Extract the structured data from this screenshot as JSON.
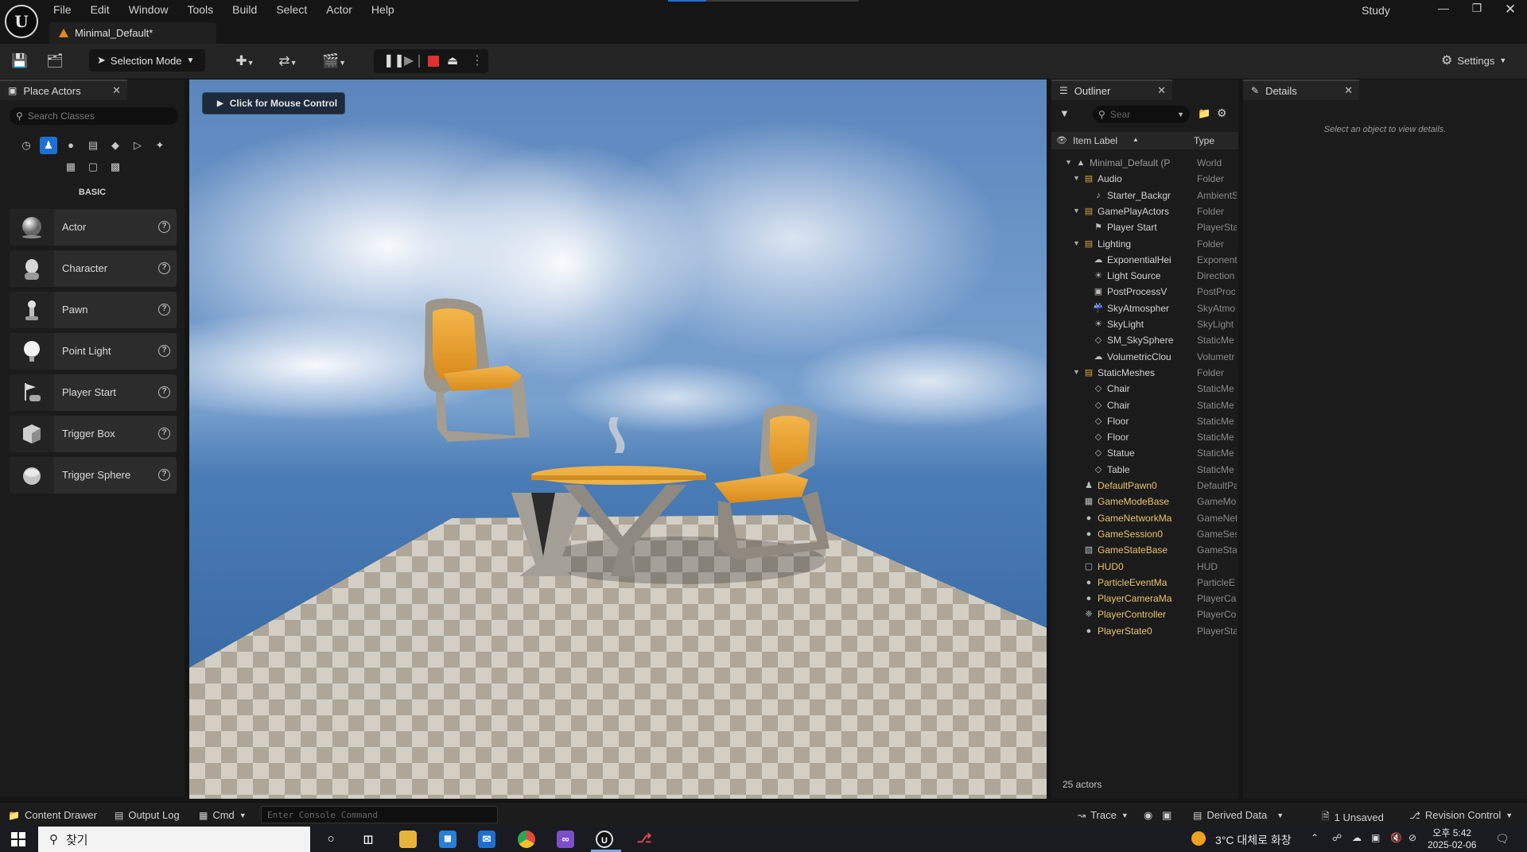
{
  "app": {
    "document_tab": "Minimal_Default*",
    "project_name": "Study",
    "menu": [
      "File",
      "Edit",
      "Window",
      "Tools",
      "Build",
      "Select",
      "Actor",
      "Help"
    ],
    "window_controls": [
      "minimize",
      "restore",
      "close"
    ]
  },
  "toolbar": {
    "selection_mode": "Selection Mode",
    "settings": "Settings"
  },
  "place_actors": {
    "tab_title": "Place Actors",
    "search_placeholder": "Search Classes",
    "category_icons": [
      "recent-icon",
      "basic-icon",
      "lights-icon",
      "cinematic-icon",
      "visual-effects-icon",
      "volumes-icon",
      "all-classes-icon",
      "geometry-icon",
      "shapes-icon",
      "extras-icon"
    ],
    "section_label": "BASIC",
    "items": [
      {
        "label": "Actor",
        "icon": "sphere-icon"
      },
      {
        "label": "Character",
        "icon": "character-icon"
      },
      {
        "label": "Pawn",
        "icon": "pawn-icon"
      },
      {
        "label": "Point Light",
        "icon": "point-light-icon"
      },
      {
        "label": "Player Start",
        "icon": "player-start-icon"
      },
      {
        "label": "Trigger Box",
        "icon": "trigger-box-icon"
      },
      {
        "label": "Trigger Sphere",
        "icon": "trigger-sphere-icon"
      }
    ]
  },
  "viewport": {
    "overlay_button": "Click for Mouse Control"
  },
  "outliner": {
    "tab_title": "Outliner",
    "search_placeholder": "Sear",
    "columns": {
      "label": "Item Label",
      "type": "Type"
    },
    "rows": [
      {
        "label": "Minimal_Default (P",
        "type": "World",
        "depth": 0,
        "expanded": true,
        "icon": "world-icon",
        "kind": "root"
      },
      {
        "label": "Audio",
        "type": "Folder",
        "depth": 1,
        "expanded": true,
        "icon": "folder-icon",
        "kind": "folder"
      },
      {
        "label": "Starter_Backgr",
        "type": "AmbientS",
        "depth": 2,
        "icon": "speaker-icon",
        "kind": "item"
      },
      {
        "label": "GamePlayActors",
        "type": "Folder",
        "depth": 1,
        "expanded": true,
        "icon": "folder-icon",
        "kind": "folder"
      },
      {
        "label": "Player Start",
        "type": "PlayerSta",
        "depth": 2,
        "icon": "player-start-icon",
        "kind": "item"
      },
      {
        "label": "Lighting",
        "type": "Folder",
        "depth": 1,
        "expanded": true,
        "icon": "folder-icon",
        "kind": "folder"
      },
      {
        "label": "ExponentialHei",
        "type": "Exponent",
        "depth": 2,
        "icon": "fog-icon",
        "kind": "item"
      },
      {
        "label": "Light Source",
        "type": "Direction",
        "depth": 2,
        "icon": "sun-icon",
        "kind": "item"
      },
      {
        "label": "PostProcessV",
        "type": "PostProc",
        "depth": 2,
        "icon": "postprocess-icon",
        "kind": "item"
      },
      {
        "label": "SkyAtmospher",
        "type": "SkyAtmo",
        "depth": 2,
        "icon": "atmosphere-icon",
        "kind": "item"
      },
      {
        "label": "SkyLight",
        "type": "SkyLight",
        "depth": 2,
        "icon": "skylight-icon",
        "kind": "item"
      },
      {
        "label": "SM_SkySphere",
        "type": "StaticMe",
        "depth": 2,
        "icon": "mesh-icon",
        "kind": "item"
      },
      {
        "label": "VolumetricClou",
        "type": "Volumetr",
        "depth": 2,
        "icon": "cloud-icon",
        "kind": "item"
      },
      {
        "label": "StaticMeshes",
        "type": "Folder",
        "depth": 1,
        "expanded": true,
        "icon": "folder-icon",
        "kind": "folder"
      },
      {
        "label": "Chair",
        "type": "StaticMe",
        "depth": 2,
        "icon": "mesh-icon",
        "kind": "item"
      },
      {
        "label": "Chair",
        "type": "StaticMe",
        "depth": 2,
        "icon": "mesh-icon",
        "kind": "item"
      },
      {
        "label": "Floor",
        "type": "StaticMe",
        "depth": 2,
        "icon": "mesh-icon",
        "kind": "item"
      },
      {
        "label": "Floor",
        "type": "StaticMe",
        "depth": 2,
        "icon": "mesh-icon",
        "kind": "item"
      },
      {
        "label": "Statue",
        "type": "StaticMe",
        "depth": 2,
        "icon": "mesh-icon",
        "kind": "item"
      },
      {
        "label": "Table",
        "type": "StaticMe",
        "depth": 2,
        "icon": "mesh-icon",
        "kind": "item"
      },
      {
        "label": "DefaultPawn0",
        "type": "DefaultPa",
        "depth": 1,
        "icon": "pawn-icon",
        "kind": "transient"
      },
      {
        "label": "GameModeBase",
        "type": "GameMo",
        "depth": 1,
        "icon": "gamemode-icon",
        "kind": "transient"
      },
      {
        "label": "GameNetworkMa",
        "type": "GameNet",
        "depth": 1,
        "icon": "actor-icon",
        "kind": "transient"
      },
      {
        "label": "GameSession0",
        "type": "GameSes",
        "depth": 1,
        "icon": "actor-icon",
        "kind": "transient"
      },
      {
        "label": "GameStateBase",
        "type": "GameSta",
        "depth": 1,
        "icon": "gamestate-icon",
        "kind": "transient"
      },
      {
        "label": "HUD0",
        "type": "HUD",
        "depth": 1,
        "icon": "hud-icon",
        "kind": "transient"
      },
      {
        "label": "ParticleEventMa",
        "type": "ParticleE",
        "depth": 1,
        "icon": "actor-icon",
        "kind": "transient"
      },
      {
        "label": "PlayerCameraMa",
        "type": "PlayerCa",
        "depth": 1,
        "icon": "actor-icon",
        "kind": "transient"
      },
      {
        "label": "PlayerController",
        "type": "PlayerCo",
        "depth": 1,
        "icon": "controller-icon",
        "kind": "transient"
      },
      {
        "label": "PlayerState0",
        "type": "PlayerSta",
        "depth": 1,
        "icon": "actor-icon",
        "kind": "transient"
      }
    ],
    "actor_count": "25 actors"
  },
  "details": {
    "tab_title": "Details",
    "hint": "Select an object to view details."
  },
  "statusbar": {
    "content_drawer": "Content Drawer",
    "output_log": "Output Log",
    "cmd": "Cmd",
    "console_placeholder": "Enter Console Command",
    "trace": "Trace",
    "derived_data": "Derived Data",
    "unsaved": "1 Unsaved",
    "revision_control": "Revision Control"
  },
  "taskbar": {
    "search_text": "찾기",
    "weather": "3°C 대체로 화창",
    "time": "오후 5:42",
    "date": "2025-02-06"
  },
  "colors": {
    "accent_blue": "#1d6fd6",
    "stop_red": "#e03030",
    "transient_label": "#e8c36a",
    "warning_orange": "#e08a1e"
  }
}
